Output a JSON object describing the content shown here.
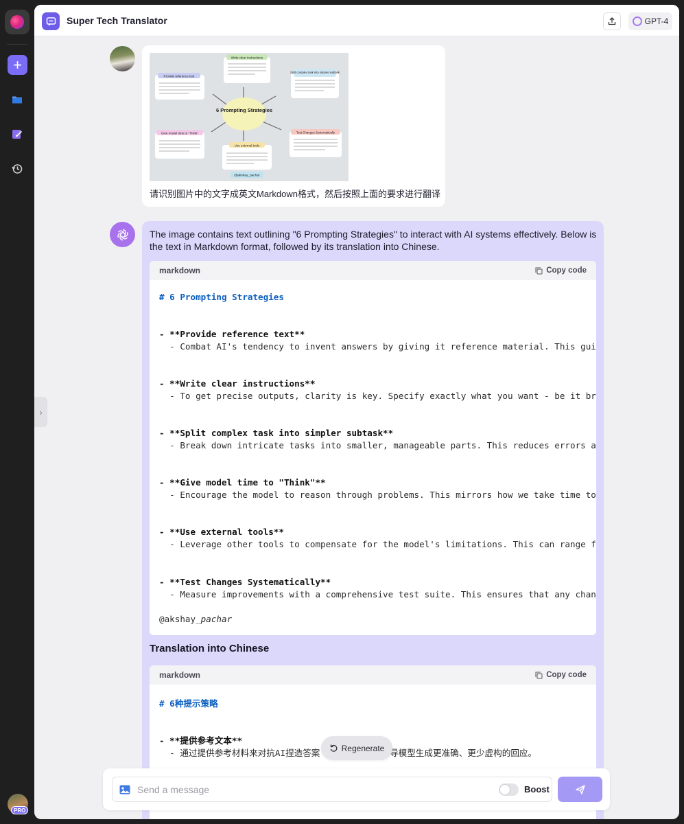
{
  "header": {
    "title": "Super Tech Translator",
    "model_label": "GPT-4"
  },
  "rail": {
    "badge": "PRO"
  },
  "user_message": {
    "text": "请识别图片中的文字成英文Markdown格式，然后按照上面的要求进行翻译",
    "image": {
      "center_label": "6 Prompting Strategies",
      "nodes": [
        "Write clear instructions",
        "Provide reference text",
        "Split complex task into simpler subtask",
        "Give model time to \"Think\"",
        "Use external tools",
        "Test Changes Systematically"
      ],
      "handle": "@akshay_pachar"
    }
  },
  "bot_message": {
    "intro": "The image contains text outlining \"6 Prompting Strategies\" to interact with AI systems effectively. Below is the text in Markdown format, followed by its translation into Chinese.",
    "code_block_1": {
      "lang": "markdown",
      "copy_label": "Copy code",
      "heading": "# 6 Prompting Strategies",
      "items": [
        {
          "title": "- **Provide reference text**",
          "desc": "  - Combat AI's tendency to invent answers by giving it reference material. This gui"
        },
        {
          "title": "- **Write clear instructions**",
          "desc": "  - To get precise outputs, clarity is key. Specify exactly what you want - be it br"
        },
        {
          "title": "- **Split complex task into simpler subtask**",
          "desc": "  - Break down intricate tasks into smaller, manageable parts. This reduces errors a"
        },
        {
          "title": "- **Give model time to \"Think\"**",
          "desc": "  - Encourage the model to reason through problems. This mirrors how we take time to"
        },
        {
          "title": "- **Use external tools**",
          "desc": "  - Leverage other tools to compensate for the model's limitations. This can range f"
        },
        {
          "title": "- **Test Changes Systematically**",
          "desc": "  - Measure improvements with a comprehensive test suite. This ensures that any chan"
        }
      ],
      "footer_prefix": "@akshay",
      "footer_italic": "_pachar"
    },
    "translation_title": "Translation into Chinese",
    "code_block_2": {
      "lang": "markdown",
      "copy_label": "Copy code",
      "heading": "# 6种提示策略",
      "item_title": "- **提供参考文本**",
      "item_desc_left": "  - 通过提供参考材料来对抗AI捏造答案",
      "item_desc_right": "导模型生成更准确、更少虚构的回应。"
    }
  },
  "regenerate_label": "Regenerate",
  "composer": {
    "placeholder": "Send a message",
    "boost_label": "Boost"
  }
}
